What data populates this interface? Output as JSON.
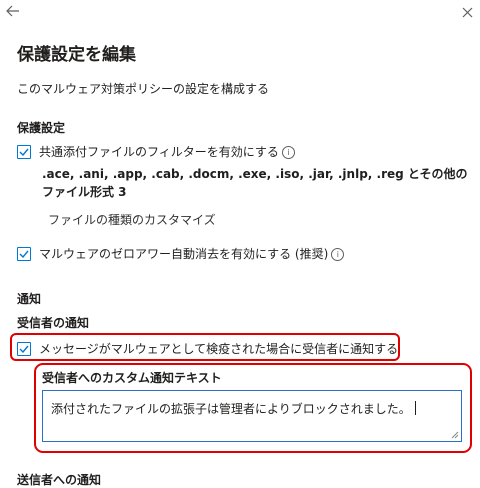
{
  "header": {
    "back_icon": "arrow-left-icon",
    "close_icon": "close-icon"
  },
  "page": {
    "title": "保護設定を編集",
    "description": "このマルウェア対策ポリシーの設定を構成する"
  },
  "protection": {
    "heading": "保護設定",
    "common_attachments_label": "共通添付ファイルのフィルターを有効にする",
    "common_attachments_checked": true,
    "file_types_text": ".ace, .ani, .app, .cab, .docm, .exe, .iso, .jar, .jnlp, .reg とその他のファイル形式 3",
    "customize_file_types": "ファイルの種類のカスタマイズ",
    "zap_label": "マルウェアのゼロアワー自動消去を有効にする (推奨)",
    "zap_checked": true
  },
  "notification": {
    "heading": "通知",
    "recipient_heading": "受信者の通知",
    "notify_recipients_label": "メッセージがマルウェアとして検疫された場合に受信者に通知する",
    "notify_recipients_checked": true,
    "custom_text_label": "受信者へのカスタム通知テキスト",
    "custom_text_value": "添付されたファイルの拡張子は管理者によりブロックされました。",
    "sender_heading": "送信者への通知"
  },
  "colors": {
    "accent": "#0078d4",
    "highlight": "#e00000"
  }
}
